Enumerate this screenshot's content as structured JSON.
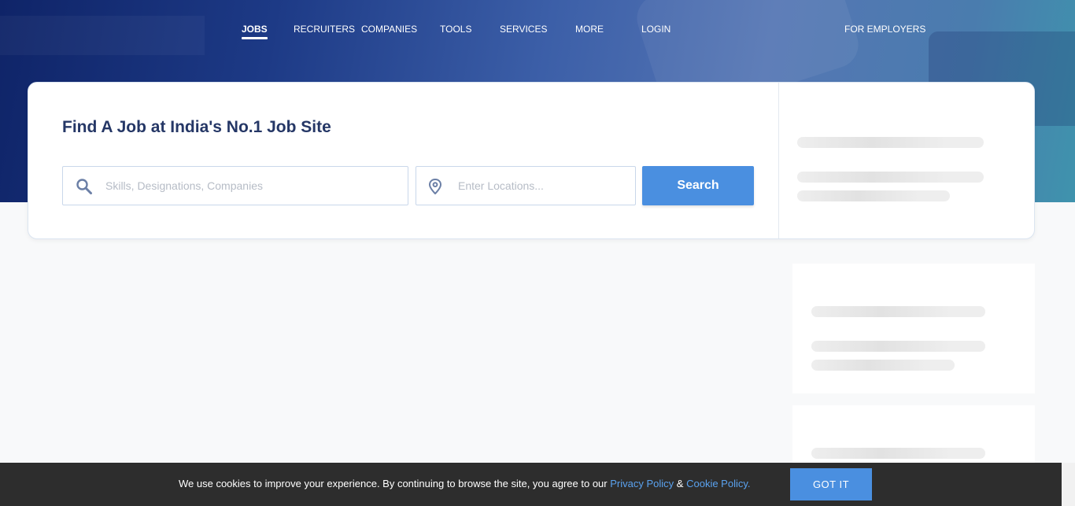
{
  "nav": {
    "items": [
      {
        "label": "JOBS",
        "active": true
      },
      {
        "label": "RECRUITERS"
      },
      {
        "label": "COMPANIES"
      },
      {
        "label": "TOOLS"
      },
      {
        "label": "SERVICES"
      },
      {
        "label": "MORE"
      },
      {
        "label": "LOGIN"
      }
    ],
    "employers_label": "FOR EMPLOYERS"
  },
  "search": {
    "title": "Find A Job at India's No.1 Job Site",
    "keyword_placeholder": "Skills, Designations, Companies",
    "location_placeholder": "Enter Locations...",
    "button_label": "Search"
  },
  "icons": {
    "keyword": "search-icon",
    "location": "location-pin-icon"
  },
  "cookie": {
    "text": "We use cookies to improve your experience. By continuing to browse the site, you agree to our",
    "privacy_link": "Privacy Policy",
    "separator": "&",
    "cookie_link": "Cookie Policy.",
    "button_label": "GOT IT"
  },
  "colors": {
    "accent": "#4a8fe0",
    "title": "#253766",
    "cookie_bar": "#2d2d2d",
    "link": "#5aa2ef"
  }
}
